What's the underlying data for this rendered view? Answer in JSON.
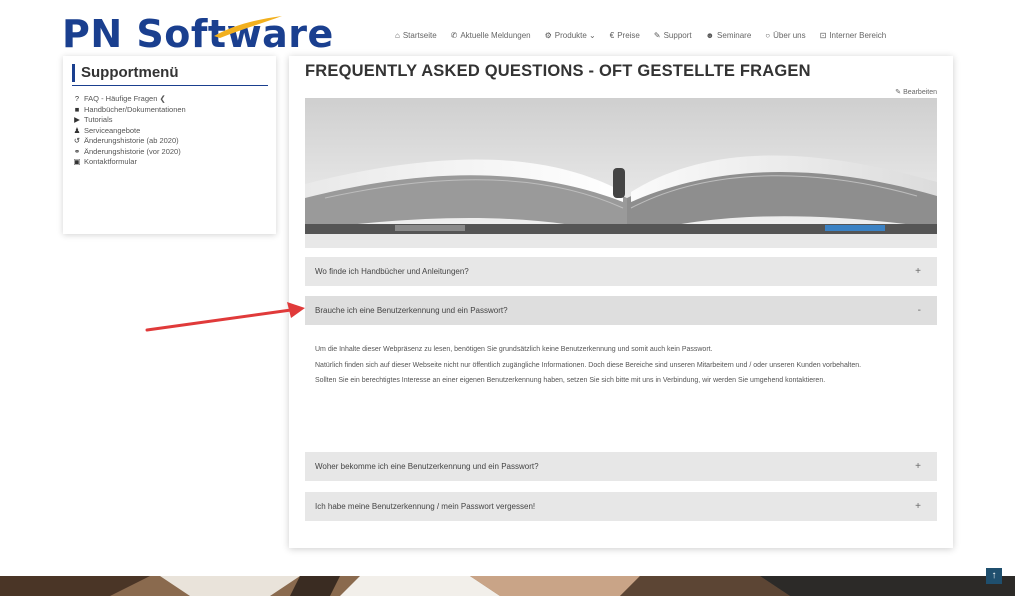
{
  "logo": {
    "pn": "PN",
    "software": "Software"
  },
  "nav": [
    {
      "icon": "home-icon",
      "glyph": "⌂",
      "label": "Startseite"
    },
    {
      "icon": "megaphone-icon",
      "glyph": "✆",
      "label": "Aktuelle Meldungen"
    },
    {
      "icon": "gear-icon",
      "glyph": "⚙",
      "label": "Produkte ⌄"
    },
    {
      "icon": "euro-icon",
      "glyph": "€",
      "label": "Preise"
    },
    {
      "icon": "wrench-icon",
      "glyph": "✎",
      "label": "Support"
    },
    {
      "icon": "users-icon",
      "glyph": "☻",
      "label": "Seminare"
    },
    {
      "icon": "info-icon",
      "glyph": "○",
      "label": "Über uns"
    },
    {
      "icon": "lock-icon",
      "glyph": "⊡",
      "label": "Interner Bereich"
    }
  ],
  "sidebar": {
    "title": "Supportmenü",
    "items": [
      {
        "icon": "question-icon",
        "glyph": "?",
        "label": "FAQ - Häufige Fragen ❮"
      },
      {
        "icon": "book-icon",
        "glyph": "■",
        "label": "Handbücher/Dokumentationen"
      },
      {
        "icon": "video-icon",
        "glyph": "▶",
        "label": "Tutorials"
      },
      {
        "icon": "service-icon",
        "glyph": "♟",
        "label": "Serviceangebote"
      },
      {
        "icon": "history-icon",
        "glyph": "↺",
        "label": "Änderungshistorie (ab 2020)"
      },
      {
        "icon": "history-old-icon",
        "glyph": "⚭",
        "label": "Änderungshistorie (vor 2020)"
      },
      {
        "icon": "form-icon",
        "glyph": "▣",
        "label": "Kontaktformular"
      }
    ]
  },
  "main": {
    "title": "FREQUENTLY ASKED QUESTIONS - OFT GESTELLTE FRAGEN",
    "edit_label": "Bearbeiten",
    "faq": [
      {
        "question": "Wo finde ich Handbücher und Anleitungen?",
        "toggle": "+"
      },
      {
        "question": "Brauche ich eine Benutzerkennung und ein Passwort?",
        "toggle": "-"
      },
      {
        "question": "Woher bekomme ich eine Benutzerkennung und ein Passwort?",
        "toggle": "+"
      },
      {
        "question": "Ich habe meine Benutzerkennung / mein Passwort vergessen!",
        "toggle": "+"
      }
    ],
    "answer": [
      "Um die Inhalte dieser Webpräsenz zu lesen, benötigen Sie grundsätzlich keine Benutzerkennung und somit auch kein Passwort.",
      "Natürlich finden sich auf dieser Webseite nicht nur öffentlich zugängliche Informationen. Doch diese Bereiche sind unseren Mitarbeitern und / oder unseren Kunden vorbehalten.",
      "Sollten Sie ein berechtigtes Interesse an einer eigenen Benutzerkennung haben, setzen Sie sich bitte mit uns in Verbindung, wir werden Sie umgehend kontaktieren."
    ]
  },
  "colors": {
    "brand_blue": "#1a3f8f",
    "accent_red": "#e03a3a",
    "accordion_bg": "#e7e7e7"
  }
}
